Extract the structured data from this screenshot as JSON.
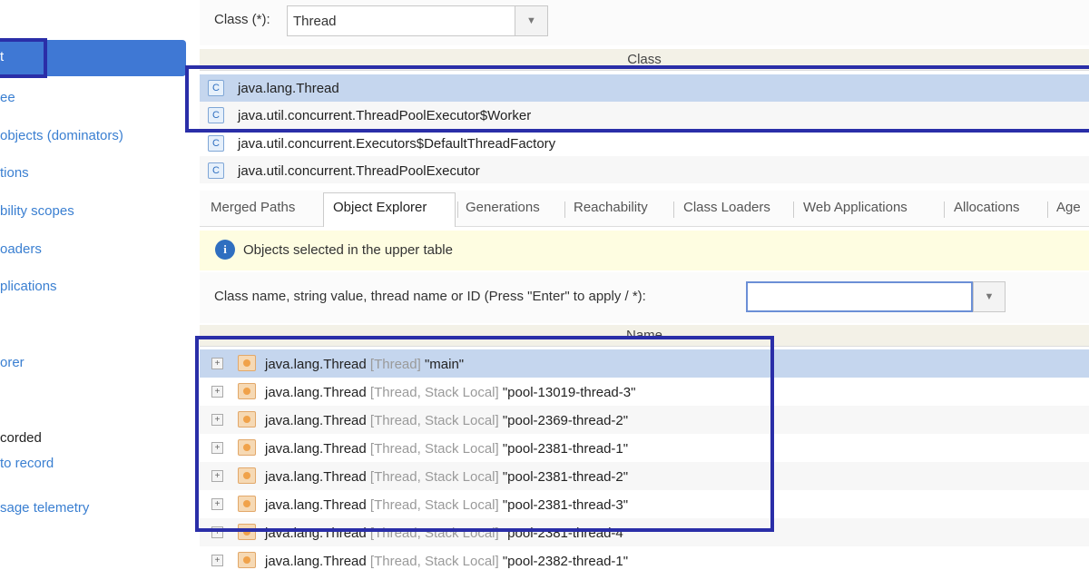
{
  "sidebar": {
    "selected_label": "t",
    "items": [
      {
        "label": "ee",
        "link": true
      },
      {
        "label": "objects (dominators)",
        "link": true
      },
      {
        "label": "tions",
        "link": true
      },
      {
        "label": "bility scopes",
        "link": true
      },
      {
        "label": "oaders",
        "link": true
      },
      {
        "label": "plications",
        "link": true
      },
      {
        "label": "orer",
        "link": true
      },
      {
        "label": "corded",
        "link": false
      },
      {
        "label": "to record",
        "link": true
      },
      {
        "label": "sage telemetry",
        "link": true
      }
    ]
  },
  "class_filter": {
    "label": "Class (*):",
    "value": "Thread"
  },
  "upper_table": {
    "header": "Class",
    "rows": [
      "java.lang.Thread",
      "java.util.concurrent.ThreadPoolExecutor$Worker",
      "java.util.concurrent.Executors$DefaultThreadFactory",
      "java.util.concurrent.ThreadPoolExecutor"
    ]
  },
  "tabs": [
    "Merged Paths",
    "Object Explorer",
    "Generations",
    "Reachability",
    "Class Loaders",
    "Web Applications",
    "Allocations",
    "Age"
  ],
  "active_tab": "Object Explorer",
  "banner": {
    "text": "Objects selected in the upper table"
  },
  "filter": {
    "label": "Class name, string value, thread name or ID (Press \"Enter\" to apply / *):",
    "value": ""
  },
  "lower_table": {
    "header": "Name",
    "rows": [
      {
        "cls": "java.lang.Thread",
        "kind": "[Thread]",
        "name": "\"main\""
      },
      {
        "cls": "java.lang.Thread",
        "kind": "[Thread, Stack Local]",
        "name": "\"pool-13019-thread-3\""
      },
      {
        "cls": "java.lang.Thread",
        "kind": "[Thread, Stack Local]",
        "name": "\"pool-2369-thread-2\""
      },
      {
        "cls": "java.lang.Thread",
        "kind": "[Thread, Stack Local]",
        "name": "\"pool-2381-thread-1\""
      },
      {
        "cls": "java.lang.Thread",
        "kind": "[Thread, Stack Local]",
        "name": "\"pool-2381-thread-2\""
      },
      {
        "cls": "java.lang.Thread",
        "kind": "[Thread, Stack Local]",
        "name": "\"pool-2381-thread-3\""
      },
      {
        "cls": "java.lang.Thread",
        "kind": "[Thread, Stack Local]",
        "name": "\"pool-2381-thread-4\""
      },
      {
        "cls": "java.lang.Thread",
        "kind": "[Thread, Stack Local]",
        "name": "\"pool-2382-thread-1\""
      }
    ]
  },
  "colors": {
    "selection": "#3f78d4",
    "row_selected": "#c5d6ee",
    "highlight_frame": "#2a2ea8",
    "link": "#3a7fd1",
    "banner_bg": "#fefde1"
  }
}
